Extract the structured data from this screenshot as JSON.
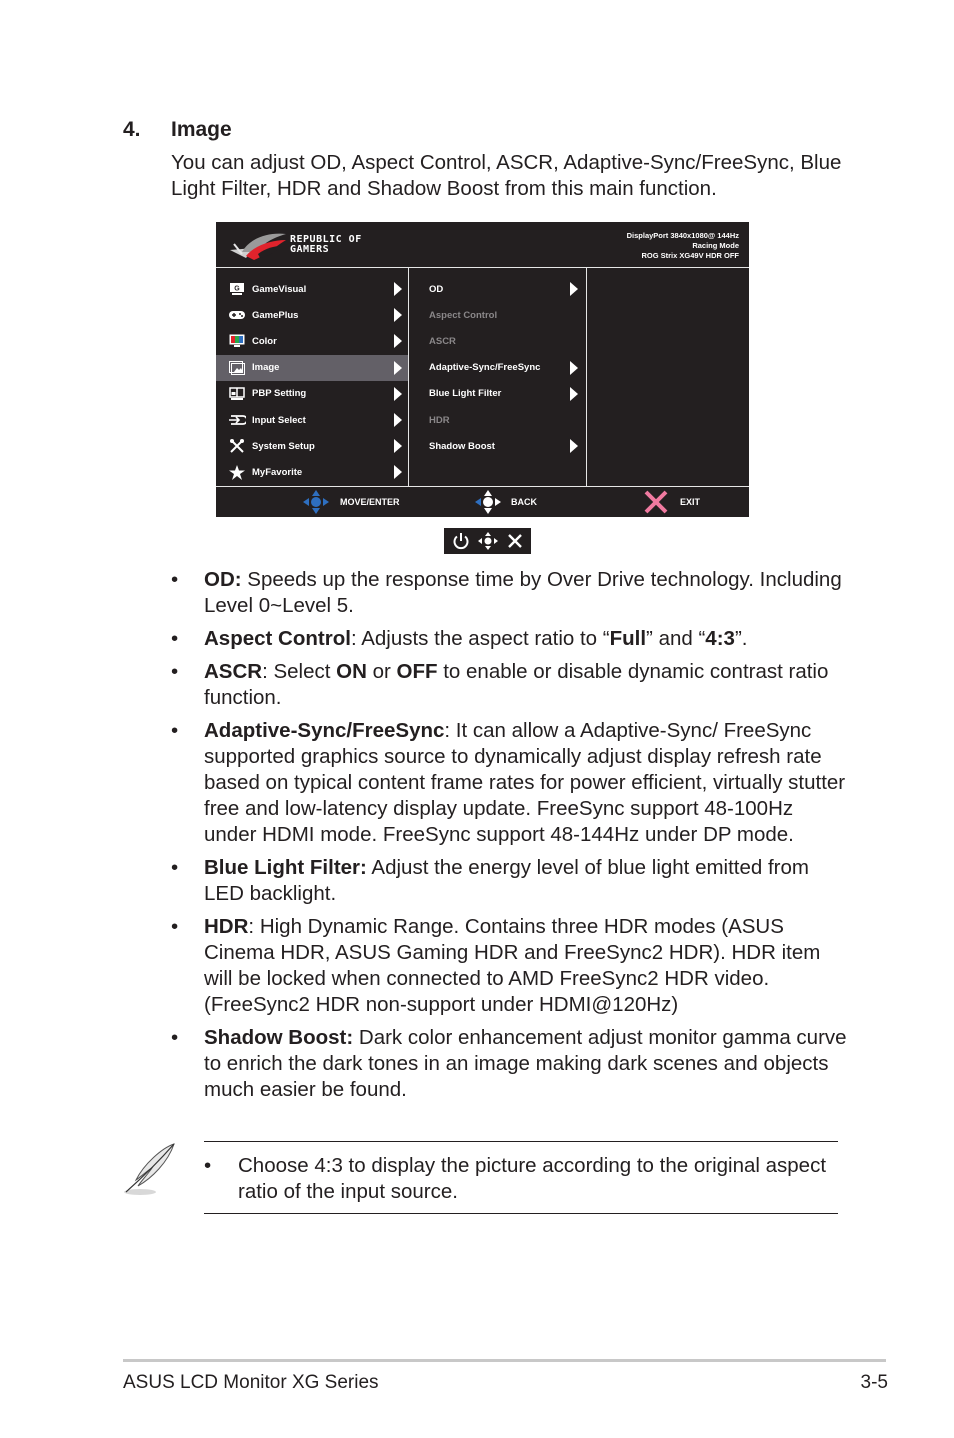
{
  "section": {
    "number": "4.",
    "title": "Image",
    "intro": "You can adjust OD, Aspect Control, ASCR, Adaptive-Sync/FreeSync, Blue Light Filter, HDR and Shadow Boost from this main function."
  },
  "osd": {
    "brand": {
      "line1": "REPUBLIC OF",
      "line2": "GAMERS",
      "logo_icon": "rog-eye-logo"
    },
    "status": [
      "DisplayPort 3840x1080@ 144Hz",
      "Racing Mode",
      "ROG Strix XG49V HDR OFF"
    ],
    "main_menu": [
      {
        "label": "GameVisual",
        "icon": "gamevisual-icon",
        "active": false
      },
      {
        "label": "GamePlus",
        "icon": "gamepad-icon",
        "active": false
      },
      {
        "label": "Color",
        "icon": "color-monitor-icon",
        "active": false
      },
      {
        "label": "Image",
        "icon": "image-icon",
        "active": true
      },
      {
        "label": "PBP Setting",
        "icon": "pbp-icon",
        "active": false
      },
      {
        "label": "Input Select",
        "icon": "input-icon",
        "active": false
      },
      {
        "label": "System Setup",
        "icon": "tools-icon",
        "active": false
      },
      {
        "label": "MyFavorite",
        "icon": "star-icon",
        "active": false
      }
    ],
    "sub_menu": [
      {
        "label": "OD",
        "enabled": true,
        "has_arrow": true
      },
      {
        "label": "Aspect Control",
        "enabled": false,
        "has_arrow": false
      },
      {
        "label": "ASCR",
        "enabled": false,
        "has_arrow": false
      },
      {
        "label": "Adaptive-Sync/FreeSync",
        "enabled": true,
        "has_arrow": true
      },
      {
        "label": "Blue Light Filter",
        "enabled": true,
        "has_arrow": true
      },
      {
        "label": "HDR",
        "enabled": false,
        "has_arrow": false
      },
      {
        "label": "Shadow Boost",
        "enabled": true,
        "has_arrow": true
      }
    ],
    "footer": {
      "move_enter": "MOVE/ENTER",
      "back": "BACK",
      "exit": "EXIT"
    },
    "colors": {
      "background": "#231f20",
      "active_row": "#636067",
      "nav_blue": "#2e6fc0",
      "exit_pink": "#f07aa0",
      "disabled_text": "#8a8789"
    }
  },
  "keybar": {
    "icons": [
      "power-icon",
      "five-way-joystick-icon",
      "close-icon"
    ]
  },
  "bullets": [
    {
      "term": "OD:",
      "parts": [
        {
          "t": " Speeds up the response time by Over Drive technology. Including Level 0~Level 5.",
          "b": false
        }
      ]
    },
    {
      "term": "Aspect Control",
      "parts": [
        {
          "t": ": Adjusts the aspect ratio to “",
          "b": false
        },
        {
          "t": "Full",
          "b": true
        },
        {
          "t": "” and “",
          "b": false
        },
        {
          "t": "4:3",
          "b": true
        },
        {
          "t": "”.",
          "b": false
        }
      ]
    },
    {
      "term": "ASCR",
      "parts": [
        {
          "t": ": Select ",
          "b": false
        },
        {
          "t": "ON",
          "b": true
        },
        {
          "t": " or ",
          "b": false
        },
        {
          "t": "OFF",
          "b": true
        },
        {
          "t": " to enable or disable dynamic contrast ratio function.",
          "b": false
        }
      ]
    },
    {
      "term": "Adaptive-Sync/FreeSync",
      "parts": [
        {
          "t": ": It can allow a Adaptive-Sync/ FreeSync supported graphics source to dynamically adjust display refresh rate based on typical content frame rates for power efficient, virtually stutter free and low-latency display update. FreeSync support 48-100Hz under HDMI mode. FreeSync support 48-144Hz under DP mode.",
          "b": false
        }
      ]
    },
    {
      "term": "Blue Light Filter:",
      "parts": [
        {
          "t": " Adjust the energy level of blue light emitted from LED backlight.",
          "b": false
        }
      ]
    },
    {
      "term": "HDR",
      "parts": [
        {
          "t": ": High Dynamic Range. Contains three HDR modes (ASUS Cinema HDR, ASUS Gaming HDR and FreeSync2 HDR). HDR item will be locked when connected to AMD FreeSync2 HDR video. (FreeSync2 HDR non-support under HDMI@120Hz)",
          "b": false
        }
      ]
    },
    {
      "term": "Shadow Boost:",
      "parts": [
        {
          "t": " Dark color enhancement adjust monitor gamma curve to enrich the dark tones in an image making dark scenes and objects much easier be found.",
          "b": false
        }
      ]
    }
  ],
  "bullet_char": "•",
  "note": {
    "icon": "feather-pen-icon",
    "text": "Choose 4:3 to display the picture according to the original aspect ratio of the input source."
  },
  "footer": {
    "left": "ASUS LCD Monitor XG Series",
    "right": "3-5"
  }
}
